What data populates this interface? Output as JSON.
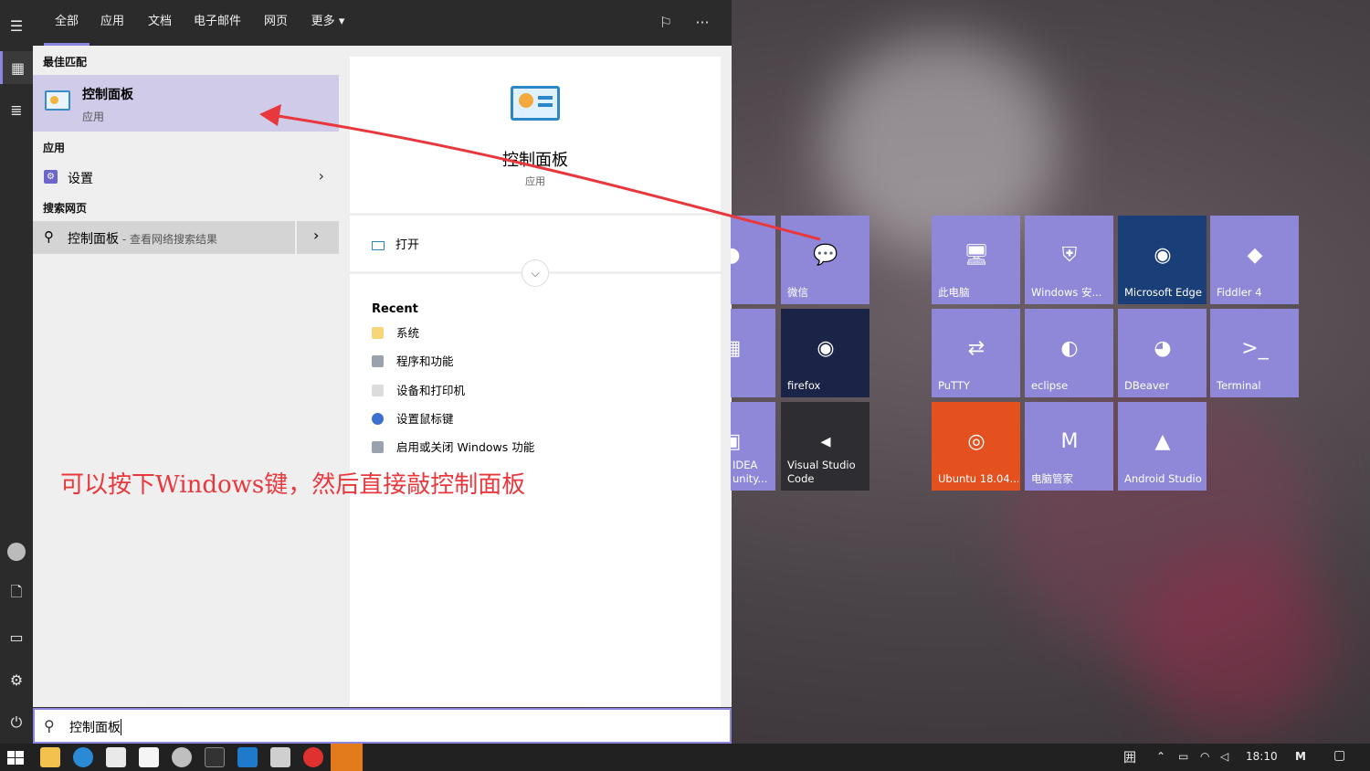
{
  "tabs": {
    "items": [
      "全部",
      "应用",
      "文档",
      "电子邮件",
      "网页",
      "更多"
    ],
    "more_arrow": "▾",
    "feedback_icon": "feedback-icon",
    "more_options": "···"
  },
  "results": {
    "best_match_header": "最佳匹配",
    "best_match": {
      "title": "控制面板",
      "type": "应用"
    },
    "apps_header": "应用",
    "apps": [
      {
        "label": "设置"
      }
    ],
    "web_header": "搜索网页",
    "web": {
      "query": "控制面板",
      "suffix": " - 查看网络搜索结果"
    }
  },
  "detail": {
    "title": "控制面板",
    "type": "应用",
    "open_label": "打开",
    "recent_header": "Recent",
    "recent": [
      "系统",
      "程序和功能",
      "设备和打印机",
      "设置鼠标键",
      "启用或关闭 Windows 功能"
    ]
  },
  "annotation": "可以按下Windows键，然后直接敲控制面板",
  "search": {
    "value": "控制面板"
  },
  "tiles": [
    {
      "label": "",
      "icon": "app-icon",
      "color": "#8f88d8"
    },
    {
      "label": "微信",
      "icon": "wechat-icon",
      "color": "#8f88d8"
    },
    {
      "label": "此电脑",
      "icon": "computer-icon",
      "color": "#8f88d8"
    },
    {
      "label": "Windows 安...",
      "icon": "shield-icon",
      "color": "#8f88d8"
    },
    {
      "label": "Microsoft Edge",
      "icon": "edge-icon",
      "color": "#1a3f78"
    },
    {
      "label": "Fiddler 4",
      "icon": "fiddler-icon",
      "color": "#8f88d8"
    },
    {
      "label": "",
      "icon": "excel-icon",
      "color": "#8f88d8"
    },
    {
      "label": "firefox",
      "icon": "firefox-icon",
      "color": "#1b2346"
    },
    {
      "label": "PuTTY",
      "icon": "putty-icon",
      "color": "#8f88d8"
    },
    {
      "label": "eclipse",
      "icon": "eclipse-icon",
      "color": "#8f88d8"
    },
    {
      "label": "DBeaver",
      "icon": "dbeaver-icon",
      "color": "#8f88d8"
    },
    {
      "label": "Terminal",
      "icon": "terminal-icon",
      "color": "#8f88d8"
    },
    {
      "label": "IDEA\nunity...",
      "icon": "idea-icon",
      "color": "#8f88d8"
    },
    {
      "label": "Visual Studio\nCode",
      "icon": "vscode-icon",
      "color": "#2d2d32"
    },
    {
      "label": "Ubuntu 18.04...",
      "icon": "ubuntu-icon",
      "color": "#e4511f"
    },
    {
      "label": "电脑管家",
      "icon": "pcmanager-icon",
      "color": "#8f88d8"
    },
    {
      "label": "Android Studio",
      "icon": "android-studio-icon",
      "color": "#8f88d8"
    }
  ],
  "taskbar": {
    "clock": "18:10",
    "ime": "囲"
  },
  "colors": {
    "accent": "#8b86e0",
    "annotation": "#e8383d",
    "tile": "#8f88d8"
  }
}
